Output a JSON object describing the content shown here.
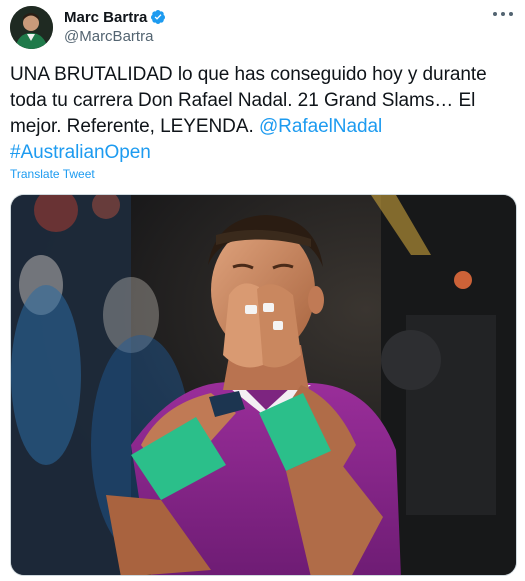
{
  "author": {
    "display_name": "Marc Bartra",
    "handle": "@MarcBartra",
    "verified": true
  },
  "tweet": {
    "text_plain": "UNA BRUTALIDAD lo que has conseguido hoy y durante toda tu carrera Don Rafael Nadal. 21 Grand Slams… El mejor. Referente, LEYENDA. ",
    "mention": "@RafaelNadal",
    "hashtag": "#AustralianOpen",
    "translate_label": "Translate Tweet"
  },
  "colors": {
    "accent": "#1d9bf0",
    "secondary_text": "#536471",
    "primary_text": "#0f1419"
  },
  "icons": {
    "verified": "verified-badge-icon",
    "more": "more-options-icon"
  }
}
